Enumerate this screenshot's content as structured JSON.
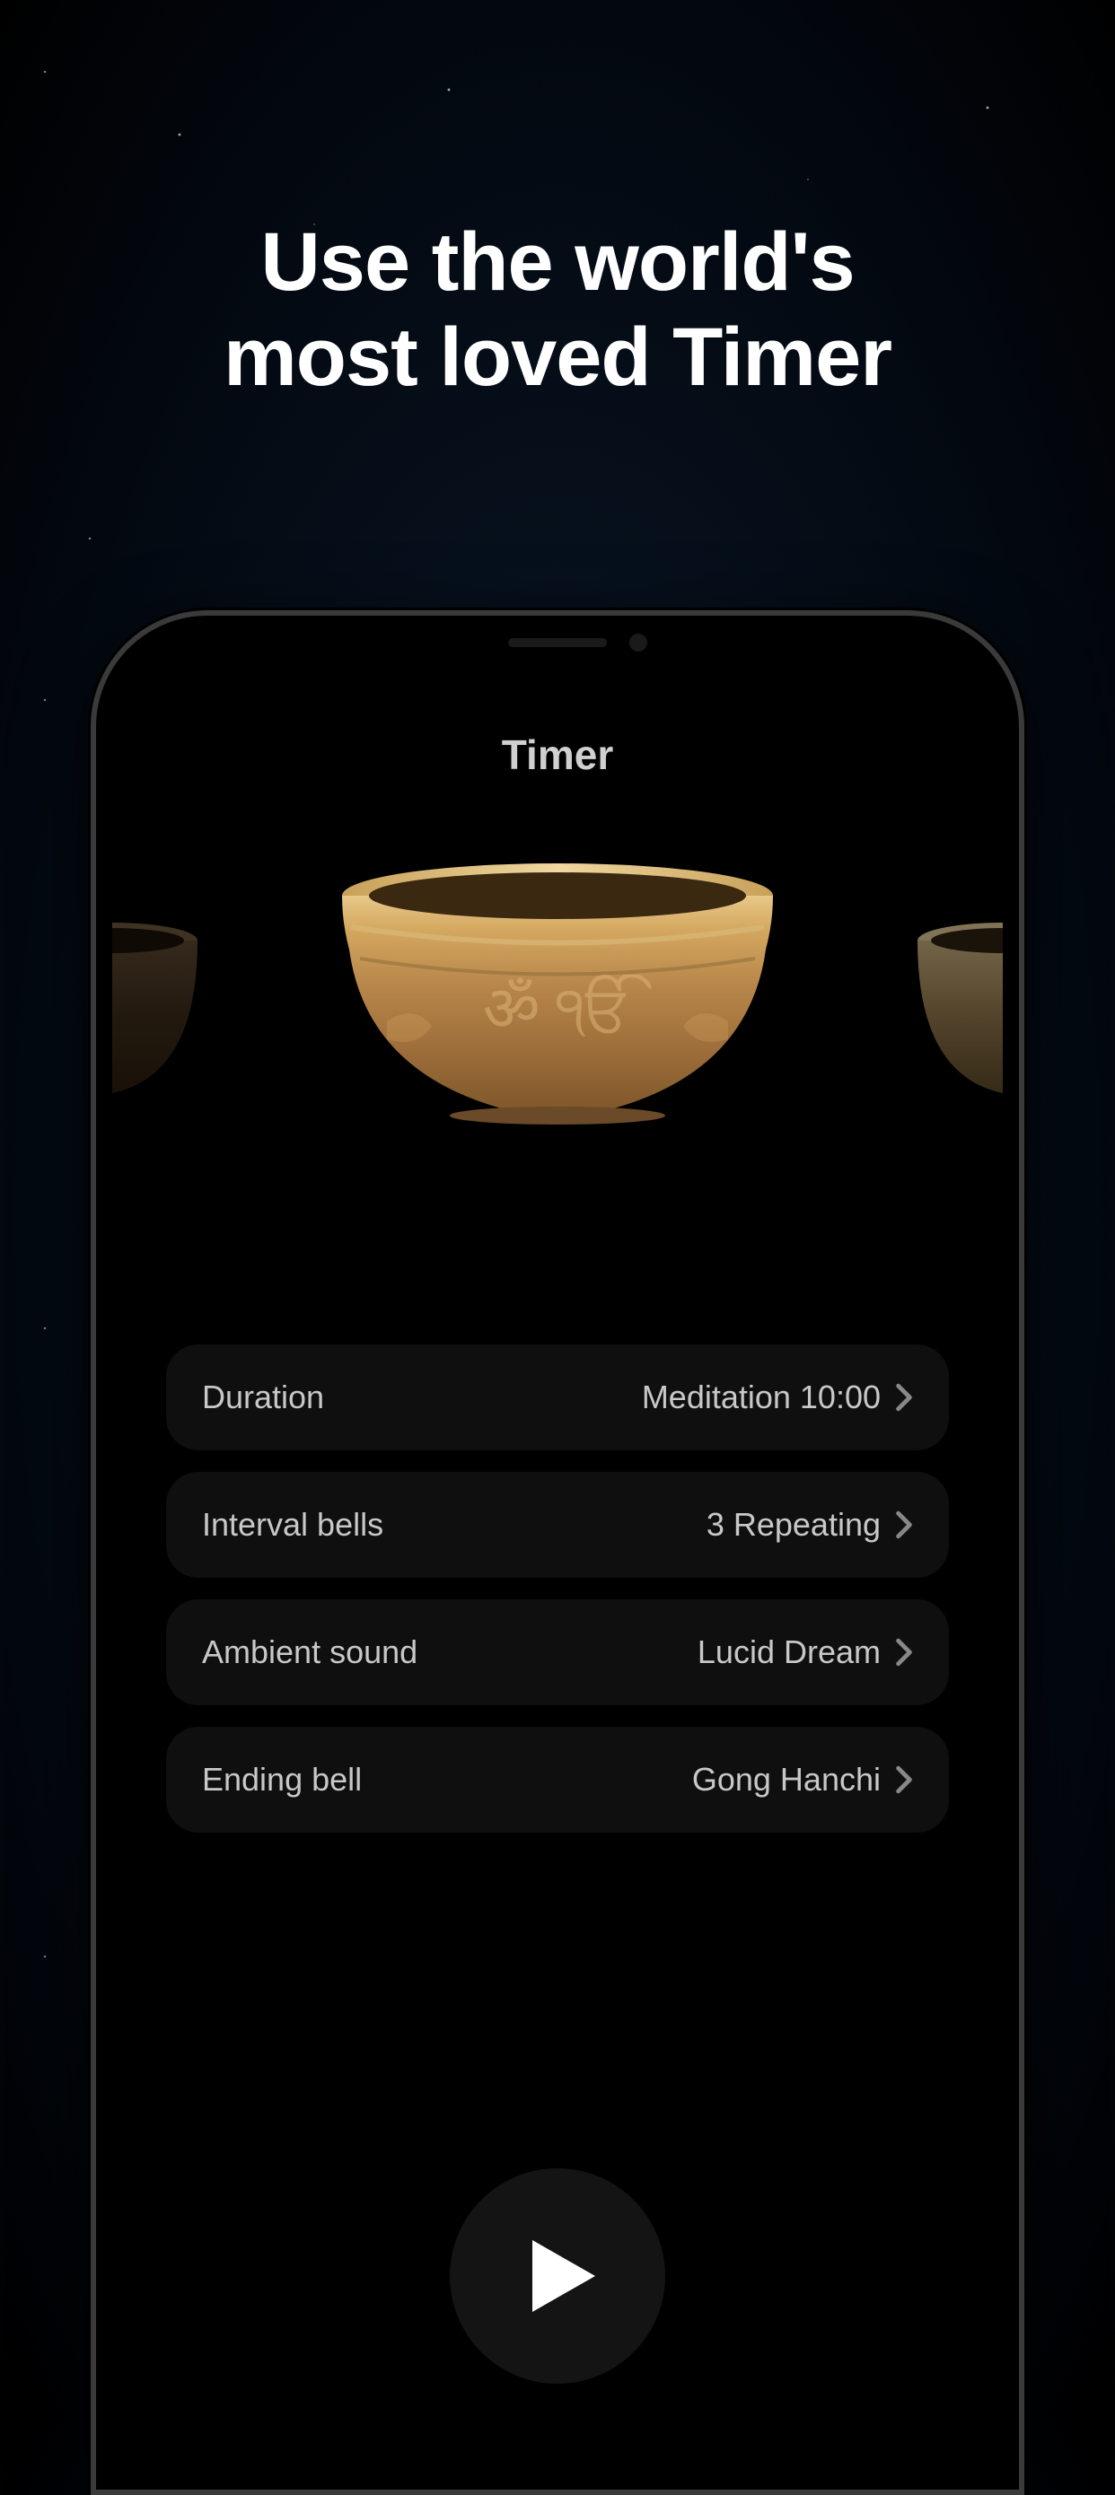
{
  "marketing": {
    "headline_line1": "Use the world's",
    "headline_line2": "most loved Timer"
  },
  "screen": {
    "title": "Timer"
  },
  "settings": [
    {
      "label": "Duration",
      "value": "Meditation 10:00"
    },
    {
      "label": "Interval bells",
      "value": "3 Repeating"
    },
    {
      "label": "Ambient sound",
      "value": "Lucid Dream"
    },
    {
      "label": "Ending bell",
      "value": "Gong Hanchi"
    }
  ]
}
